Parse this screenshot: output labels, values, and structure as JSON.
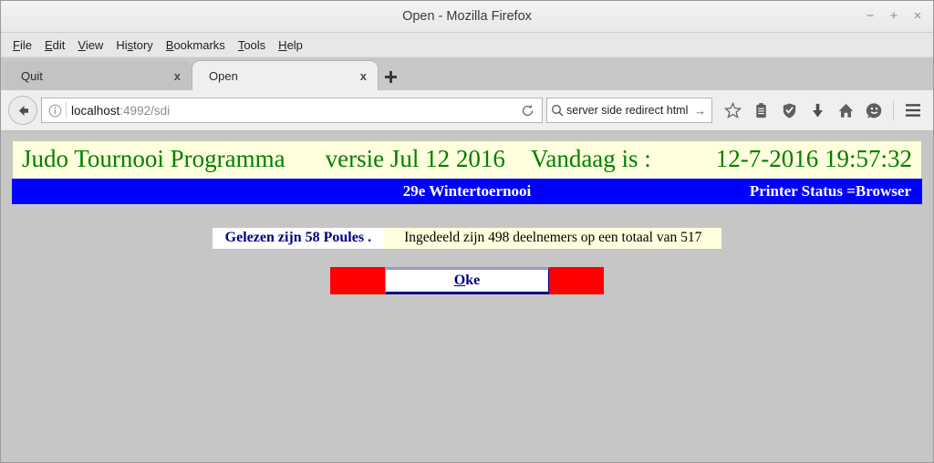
{
  "window": {
    "title": "Open - Mozilla Firefox",
    "controls": {
      "minimize": "−",
      "maximize": "+",
      "close": "×"
    }
  },
  "menubar": {
    "items": [
      {
        "pre": "",
        "accel": "F",
        "post": "ile"
      },
      {
        "pre": "",
        "accel": "E",
        "post": "dit"
      },
      {
        "pre": "",
        "accel": "V",
        "post": "iew"
      },
      {
        "pre": "Hi",
        "accel": "s",
        "post": "tory"
      },
      {
        "pre": "",
        "accel": "B",
        "post": "ookmarks"
      },
      {
        "pre": "",
        "accel": "T",
        "post": "ools"
      },
      {
        "pre": "",
        "accel": "H",
        "post": "elp"
      }
    ]
  },
  "tabs": {
    "items": [
      {
        "label": "Quit",
        "close": "x",
        "active": false
      },
      {
        "label": "Open",
        "close": "x",
        "active": true
      }
    ],
    "new_tab_label": "+"
  },
  "navbar": {
    "url_host": "localhost",
    "url_path": ":4992/sdi",
    "reload_label": "⟳",
    "search_value": "server side redirect html",
    "search_go": "→"
  },
  "page": {
    "banner": {
      "title": "Judo Tournooi Programma",
      "version": "versie Jul 12 2016",
      "today_label": "Vandaag is :",
      "datetime": "12-7-2016 19:57:32"
    },
    "bluebar": {
      "tournament": "29e Wintertoernooi",
      "printer_status": "Printer Status =Browser"
    },
    "status": {
      "poules_text": "Gelezen zijn 58 Poules .",
      "participants_text": "Ingedeeld zijn 498 deelnemers op een totaal van 517"
    },
    "buttons": {
      "oke_accel": "O",
      "oke_rest": "ke"
    }
  },
  "colors": {
    "banner_bg": "#FFFFDD",
    "banner_text": "#008000",
    "bluebar_bg": "#0000FF",
    "bluebar_text": "#FFFFFF",
    "red_block": "#FF0000",
    "navy_text": "#000080",
    "page_bg": "#C6C6C6"
  }
}
